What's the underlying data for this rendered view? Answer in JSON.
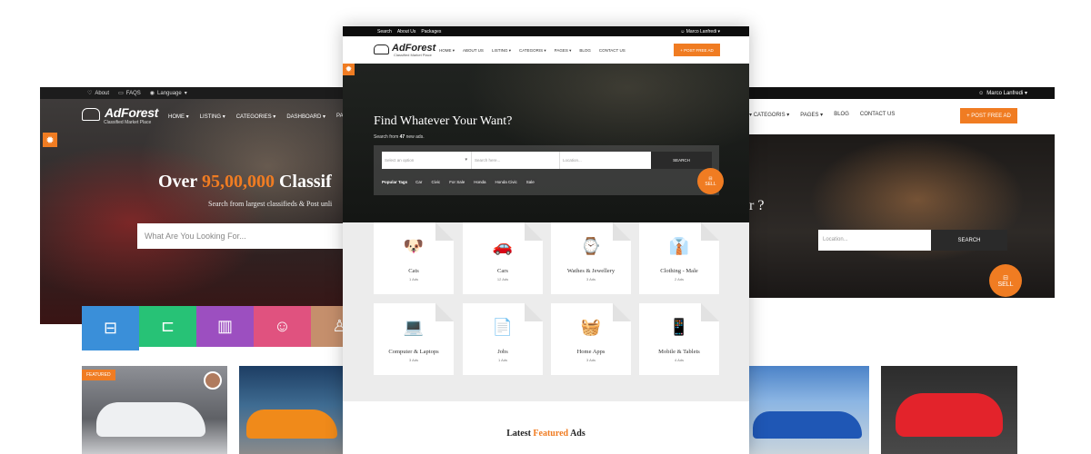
{
  "left": {
    "topbar": [
      "About",
      "FAQS",
      "Language"
    ],
    "logo_name": "AdForest",
    "logo_tag": "Classified Market Place",
    "menu": [
      "HOME",
      "LISTING",
      "CATEGORIES",
      "DASHBOARD",
      "PA"
    ],
    "headline_pre": "Over ",
    "headline_accent": "95,00,000",
    "headline_post": " Classif",
    "subtitle": "Search from largest classifieds & Post unli",
    "search_placeholder": "What Are You Looking For...",
    "featured_badge": "FEATURED"
  },
  "center": {
    "topbar": [
      "Search",
      "About Us",
      "Packages"
    ],
    "user": "Marco Lanfredi",
    "logo_name": "AdForest",
    "logo_tag": "Classified Market Place",
    "menu": [
      "HOME",
      "ABOUT US",
      "LISTING",
      "CATEGORIS",
      "PAGES",
      "BLOG",
      "CONTACT US"
    ],
    "post_button": "POST FREE AD",
    "hero_title": "Find Whatever Your Want?",
    "hero_sub_pre": "Search from ",
    "hero_sub_count": "47",
    "hero_sub_post": " new ads.",
    "select_placeholder": "Select an option",
    "search_placeholder": "Search here...",
    "location_placeholder": "Location...",
    "search_button": "SEARCH",
    "popular_label": "Popular Tags",
    "tags": [
      "Car",
      "Civic",
      "For Sale",
      "Honda",
      "Honda Civic",
      "Sale"
    ],
    "sell_label": "SELL",
    "categories": [
      {
        "title": "Cats",
        "count": "1 Ads",
        "icon": "dog-icon"
      },
      {
        "title": "Cars",
        "count": "12 Ads",
        "icon": "car-icon"
      },
      {
        "title": "Wathes & Jewellery",
        "count": "3 Ads",
        "icon": "watch-icon"
      },
      {
        "title": "Clothing - Male",
        "count": "2 Ads",
        "icon": "clothing-icon"
      },
      {
        "title": "Computer & Laptops",
        "count": "3 Ads",
        "icon": "computer-icon"
      },
      {
        "title": "Jobs",
        "count": "1 Ads",
        "icon": "jobs-icon"
      },
      {
        "title": "Home Apps",
        "count": "3 Ads",
        "icon": "appliance-icon"
      },
      {
        "title": "Mobile & Tablets",
        "count": "4 Ads",
        "icon": "phone-icon"
      }
    ],
    "latest_pre": "Latest ",
    "latest_accent": "Featured",
    "latest_post": " Ads"
  },
  "right": {
    "user": "Marco Lanfredi",
    "menu": [
      "CATEGORIS",
      "PAGES",
      "BLOG",
      "CONTACT US"
    ],
    "post_button": "POST FREE AD",
    "hero_fragment": "r ?",
    "location_placeholder": "Location...",
    "search_button": "SEARCH",
    "sell_label": "SELL"
  },
  "colors": {
    "accent": "#f07c22",
    "dark": "#0c0c0c"
  }
}
